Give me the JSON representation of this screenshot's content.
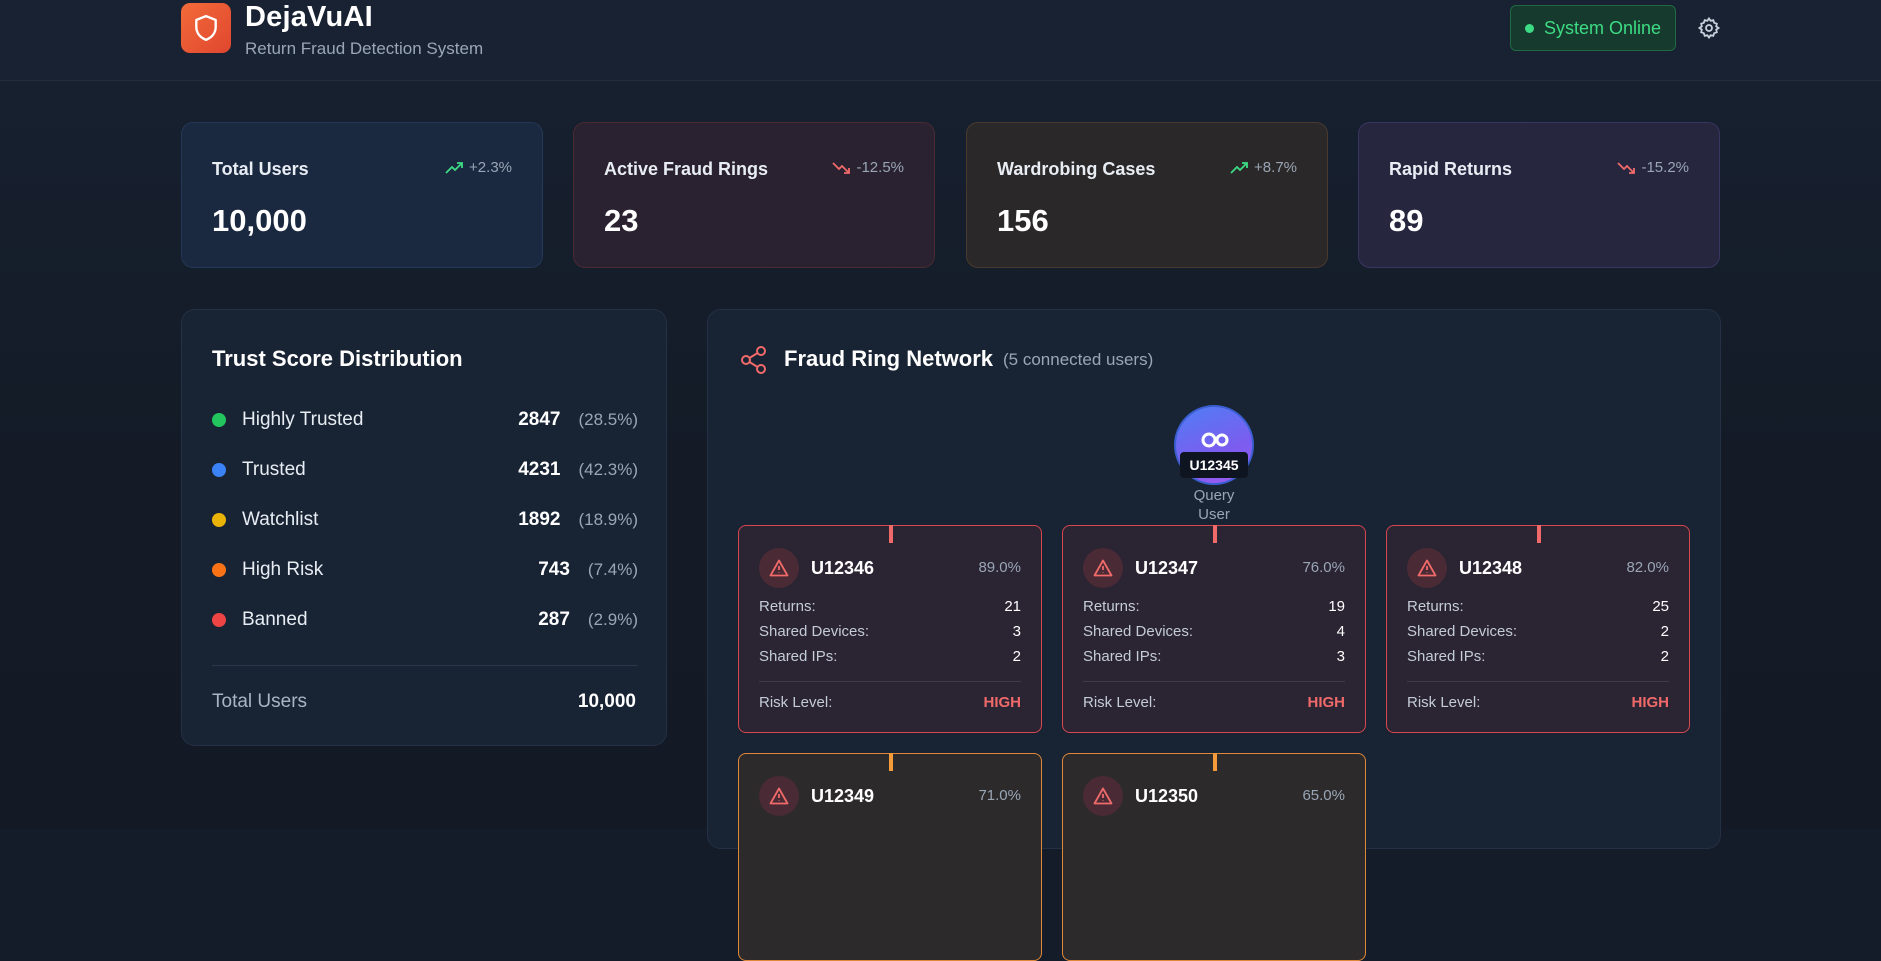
{
  "header": {
    "title": "DejaVuAI",
    "subtitle": "Return Fraud Detection System",
    "status": "System Online"
  },
  "stats": [
    {
      "label": "Total Users",
      "value": "10,000",
      "change": "+2.3%",
      "trend": "up"
    },
    {
      "label": "Active Fraud Rings",
      "value": "23",
      "change": "-12.5%",
      "trend": "down"
    },
    {
      "label": "Wardrobing Cases",
      "value": "156",
      "change": "+8.7%",
      "trend": "up"
    },
    {
      "label": "Rapid Returns",
      "value": "89",
      "change": "-15.2%",
      "trend": "down"
    }
  ],
  "trust": {
    "title": "Trust Score Distribution",
    "rows": [
      {
        "label": "Highly Trusted",
        "count": "2847",
        "pct": "(28.5%)",
        "color": "#22c55e"
      },
      {
        "label": "Trusted",
        "count": "4231",
        "pct": "(42.3%)",
        "color": "#3b82f6"
      },
      {
        "label": "Watchlist",
        "count": "1892",
        "pct": "(18.9%)",
        "color": "#eab308"
      },
      {
        "label": "High Risk",
        "count": "743",
        "pct": "(7.4%)",
        "color": "#f97316"
      },
      {
        "label": "Banned",
        "count": "287",
        "pct": "(2.9%)",
        "color": "#ef4444"
      }
    ],
    "total_label": "Total Users",
    "total_value": "10,000"
  },
  "network": {
    "title": "Fraud Ring Network",
    "subtitle": "(5 connected users)",
    "query_user": "U12345",
    "query_label_1": "Query",
    "query_label_2": "User",
    "stat_labels": {
      "returns": "Returns:",
      "devices": "Shared Devices:",
      "ips": "Shared IPs:",
      "risk": "Risk Level:"
    },
    "nodes": [
      {
        "id": "U12346",
        "score": "89.0%",
        "returns": "21",
        "devices": "3",
        "ips": "2",
        "risk": "HIGH"
      },
      {
        "id": "U12347",
        "score": "76.0%",
        "returns": "19",
        "devices": "4",
        "ips": "3",
        "risk": "HIGH"
      },
      {
        "id": "U12348",
        "score": "82.0%",
        "returns": "25",
        "devices": "2",
        "ips": "2",
        "risk": "HIGH"
      },
      {
        "id": "U12349",
        "score": "71.0%"
      },
      {
        "id": "U12350",
        "score": "65.0%"
      }
    ]
  },
  "colors": {
    "accent_green": "#3ddc84",
    "risk_high": "#f06a6a",
    "risk_medium": "#f59b3a"
  }
}
